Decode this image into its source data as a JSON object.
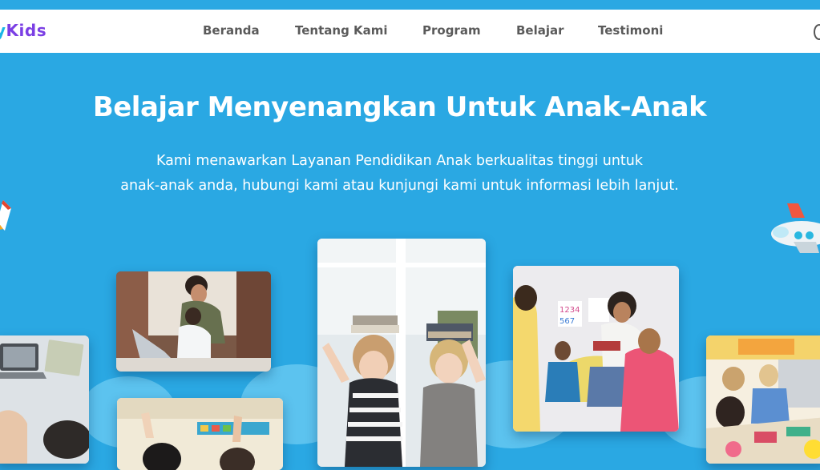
{
  "brand": {
    "logo_part1": "y",
    "logo_part2": "Kids"
  },
  "nav": {
    "items": [
      "Beranda",
      "Tentang Kami",
      "Program",
      "Belajar",
      "Testimoni"
    ]
  },
  "hero": {
    "title": "Belajar Menyenangkan Untuk Anak-Anak",
    "subtitle_line1": "Kami menawarkan Layanan Pendidikan Anak berkualitas tinggi untuk",
    "subtitle_line2": "anak-anak anda, hubungi kami atau kunjungi kami untuk informasi lebih lanjut."
  },
  "colors": {
    "background": "#2aa8e3",
    "logo_blue": "#19b6e6",
    "logo_purple": "#7b3fe4",
    "nav_text": "#5a5a5a"
  },
  "photos": [
    "photo-laptop-desk",
    "photo-parent-child-laptop",
    "photo-classroom-hands-raised",
    "photo-kids-books-on-heads",
    "photo-teacher-reading-circle",
    "photo-kids-craft-table"
  ],
  "decorations": [
    "rocket-icon",
    "airplane-icon"
  ]
}
